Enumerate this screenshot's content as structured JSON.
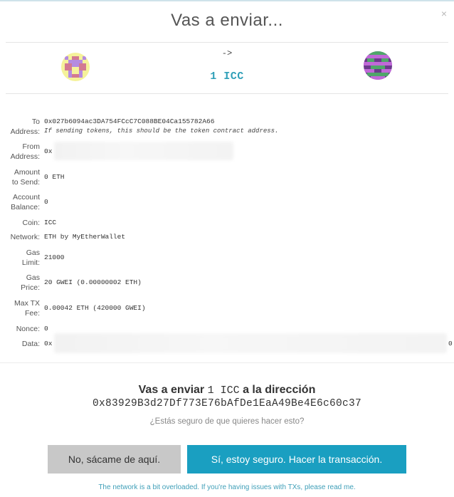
{
  "modal": {
    "title": "Vas a enviar...",
    "close_icon": "×"
  },
  "transfer": {
    "arrow": "->",
    "amount_label": "1 ICC",
    "from_identicon": "identicon-sender",
    "to_identicon": "identicon-recipient"
  },
  "details": {
    "to": {
      "label_1": "To",
      "label_2": "Address:",
      "value": "0x027b6094ac3DA754FCcC7C088BE04Ca155782A66",
      "hint": "If sending tokens, this should be the token contract address."
    },
    "from": {
      "label_1": "From",
      "label_2": "Address:",
      "value": "0x"
    },
    "amount": {
      "label_1": "Amount",
      "label_2": "to Send:",
      "value": "0 ETH"
    },
    "balance": {
      "label_1": "Account",
      "label_2": "Balance:",
      "value": "0"
    },
    "coin": {
      "label": "Coin:",
      "value": "ICC"
    },
    "network": {
      "label": "Network:",
      "value": "ETH by MyEtherWallet"
    },
    "gas_limit": {
      "label_1": "Gas",
      "label_2": "Limit:",
      "value": "21000"
    },
    "gas_price": {
      "label_1": "Gas",
      "label_2": "Price:",
      "value": "20 GWEI (0.00000002 ETH)"
    },
    "max_fee": {
      "label_1": "Max TX",
      "label_2": "Fee:",
      "value": "0.00042 ETH (420000 GWEI)"
    },
    "nonce": {
      "label": "Nonce:",
      "value": "0"
    },
    "data": {
      "label": "Data:",
      "value": "0x",
      "tail": "0"
    }
  },
  "confirmation": {
    "prefix": "Vas a enviar",
    "amount": "1 ICC",
    "suffix": "a la dirección",
    "address": "0x83929B3d27Df773E76bAfDe1EaA49Be4E6c60c37",
    "question": "¿Estás seguro de que quieres hacer esto?"
  },
  "buttons": {
    "cancel": "No, sácame de aquí.",
    "confirm": "Sí, estoy seguro. Hacer la transacción."
  },
  "footer": "The network is a bit overloaded. If you're having issues with TXs, please read me.",
  "colors": {
    "accent": "#1a9fc1",
    "amount_text": "#2f9fb8",
    "cancel_bg": "#c8c8c8"
  }
}
